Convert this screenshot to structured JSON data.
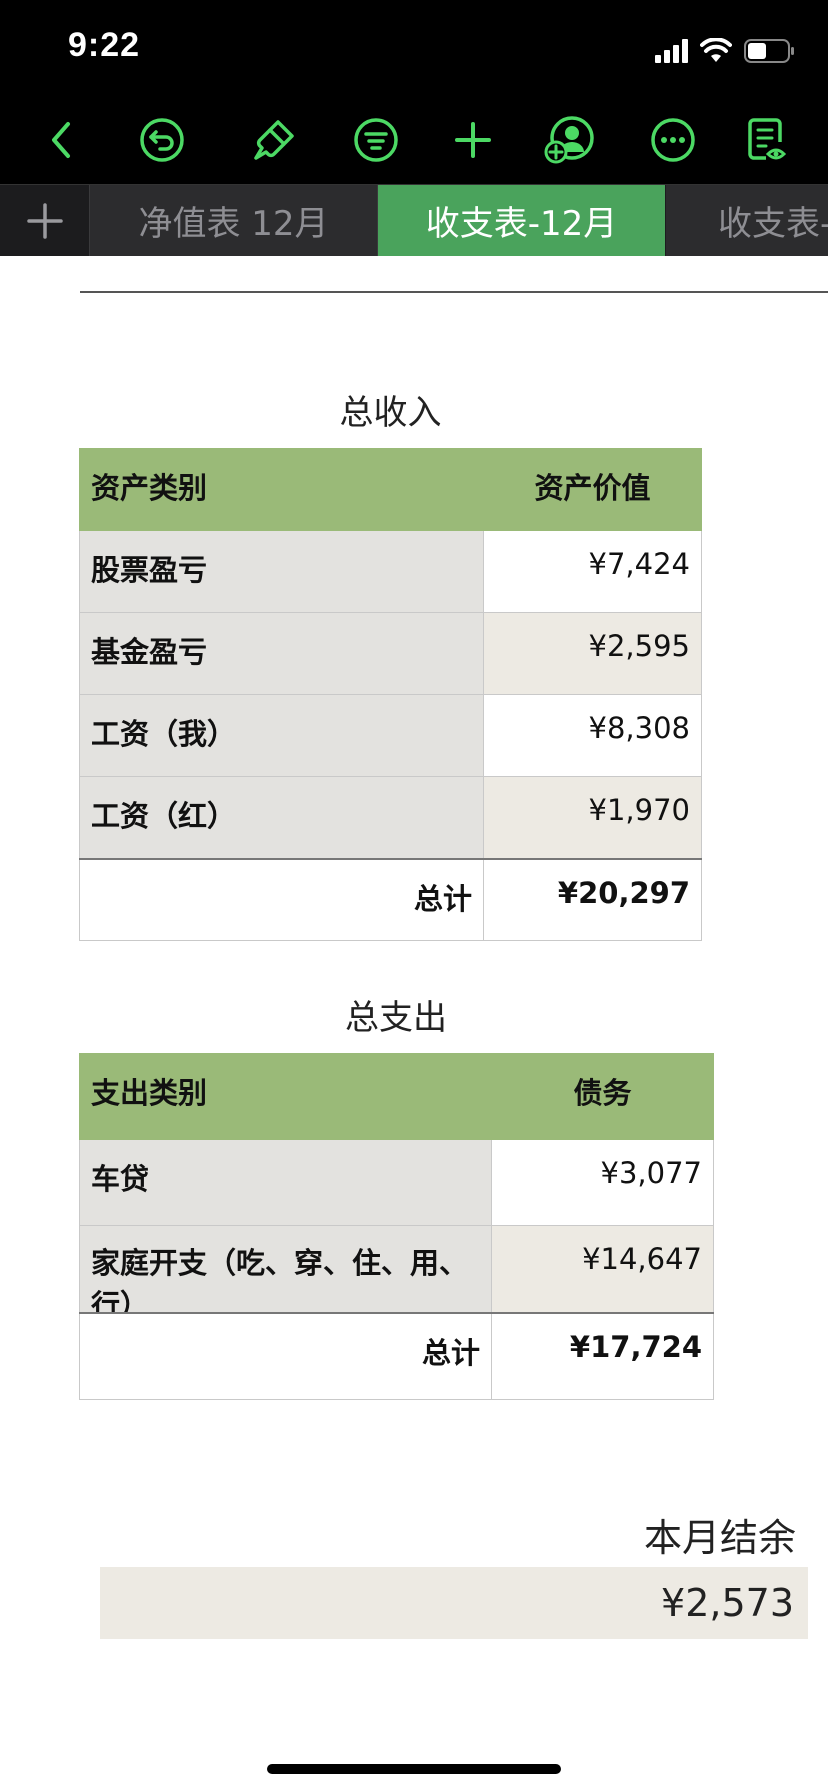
{
  "status": {
    "time": "9:22"
  },
  "toolbar": {
    "icons": [
      "back-icon",
      "undo-icon",
      "brush-icon",
      "filter-icon",
      "plus-icon",
      "collaborate-icon",
      "more-icon",
      "reader-icon"
    ],
    "accent": "#4cd964"
  },
  "tabs": {
    "add": "+",
    "items": [
      "净值表 12月",
      "收支表-12月",
      "收支表-"
    ],
    "active_color": "#4aa35c"
  },
  "income": {
    "caption": "总收入",
    "headers": [
      "资产类别",
      "资产价值"
    ],
    "rows": [
      {
        "label": "股票盈亏",
        "value": "¥7,424"
      },
      {
        "label": "基金盈亏",
        "value": "¥2,595"
      },
      {
        "label": "工资（我）",
        "value": "¥8,308"
      },
      {
        "label": "工资（红）",
        "value": "¥1,970"
      }
    ],
    "total_label": "总计",
    "total_value": "¥20,297"
  },
  "expense": {
    "caption": "总支出",
    "headers": [
      "支出类别",
      "债务"
    ],
    "rows": [
      {
        "label": "车贷",
        "value": "¥3,077"
      },
      {
        "label": "家庭开支（吃、穿、住、用、行）",
        "value": "¥14,647"
      }
    ],
    "total_label": "总计",
    "total_value": "¥17,724"
  },
  "balance": {
    "label": "本月结余",
    "value": "¥2,573"
  },
  "colors": {
    "header_green": "#9aba78",
    "label_gray": "#e3e2df",
    "value_beige": "#edeae3"
  }
}
